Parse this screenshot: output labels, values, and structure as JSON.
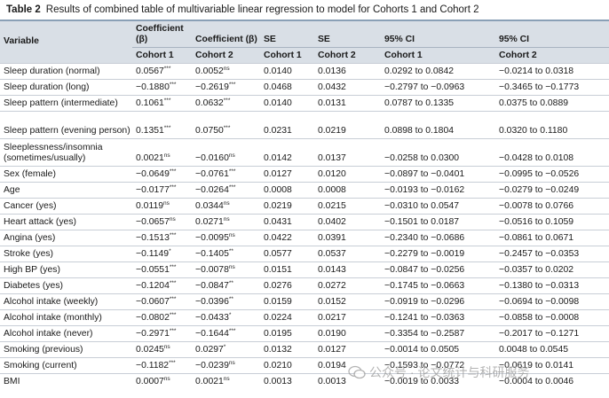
{
  "caption": {
    "label": "Table 2",
    "title": "Results of combined table of multivariable linear regression to model for Cohorts 1 and Cohort 2"
  },
  "header": {
    "variable": "Variable",
    "coef1": "Coefficient (β)",
    "coef2": "Coefficient (β)",
    "se1": "SE",
    "se2": "SE",
    "ci1": "95% CI",
    "ci2": "95% CI",
    "cohort1": "Cohort 1",
    "cohort2": "Cohort 2"
  },
  "rows": [
    {
      "label": "Sleep duration (normal)",
      "b1": "0.0567",
      "s1": "***",
      "b2": "0.0052",
      "s2": "ns",
      "se1": "0.0140",
      "se2": "0.0136",
      "ci1": "0.0292 to 0.0842",
      "ci2": "−0.0214 to 0.0318"
    },
    {
      "label": "Sleep duration (long)",
      "b1": "−0.1880",
      "s1": "***",
      "b2": "−0.2619",
      "s2": "***",
      "se1": "0.0468",
      "se2": "0.0432",
      "ci1": "−0.2797 to −0.0963",
      "ci2": "−0.3465 to −0.1773"
    },
    {
      "label": "Sleep pattern (intermediate)",
      "b1": "0.1061",
      "s1": "***",
      "b2": "0.0632",
      "s2": "***",
      "se1": "0.0140",
      "se2": "0.0131",
      "ci1": "0.0787 to 0.1335",
      "ci2": "0.0375 to 0.0889"
    },
    {
      "label": "Sleep pattern (evening person)",
      "b1": "0.1351",
      "s1": "***",
      "b2": "0.0750",
      "s2": "***",
      "se1": "0.0231",
      "se2": "0.0219",
      "ci1": "0.0898 to 0.1804",
      "ci2": "0.0320 to 0.1180",
      "tall": true
    },
    {
      "label": "Sleeplessness/insomnia (sometimes/usually)",
      "b1": "0.0021",
      "s1": "ns",
      "b2": "−0.0160",
      "s2": "ns",
      "se1": "0.0142",
      "se2": "0.0137",
      "ci1": "−0.0258 to 0.0300",
      "ci2": "−0.0428 to 0.0108",
      "tall": true
    },
    {
      "label": "Sex (female)",
      "b1": "−0.0649",
      "s1": "***",
      "b2": "−0.0761",
      "s2": "***",
      "se1": "0.0127",
      "se2": "0.0120",
      "ci1": "−0.0897 to −0.0401",
      "ci2": "−0.0995 to −0.0526"
    },
    {
      "label": "Age",
      "b1": "−0.0177",
      "s1": "***",
      "b2": "−0.0264",
      "s2": "***",
      "se1": "0.0008",
      "se2": "0.0008",
      "ci1": "−0.0193 to −0.0162",
      "ci2": "−0.0279 to −0.0249"
    },
    {
      "label": "Cancer (yes)",
      "b1": "0.0119",
      "s1": "ns",
      "b2": "0.0344",
      "s2": "ns",
      "se1": "0.0219",
      "se2": "0.0215",
      "ci1": "−0.0310 to 0.0547",
      "ci2": "−0.0078 to 0.0766"
    },
    {
      "label": "Heart attack (yes)",
      "b1": "−0.0657",
      "s1": "ns",
      "b2": "0.0271",
      "s2": "ns",
      "se1": "0.0431",
      "se2": "0.0402",
      "ci1": "−0.1501 to 0.0187",
      "ci2": "−0.0516 to 0.1059"
    },
    {
      "label": "Angina (yes)",
      "b1": "−0.1513",
      "s1": "***",
      "b2": "−0.0095",
      "s2": "ns",
      "se1": "0.0422",
      "se2": "0.0391",
      "ci1": "−0.2340 to −0.0686",
      "ci2": "−0.0861 to 0.0671"
    },
    {
      "label": "Stroke (yes)",
      "b1": "−0.1149",
      "s1": "*",
      "b2": "−0.1405",
      "s2": "**",
      "se1": "0.0577",
      "se2": "0.0537",
      "ci1": "−0.2279 to −0.0019",
      "ci2": "−0.2457 to −0.0353"
    },
    {
      "label": "High BP (yes)",
      "b1": "−0.0551",
      "s1": "***",
      "b2": "−0.0078",
      "s2": "ns",
      "se1": "0.0151",
      "se2": "0.0143",
      "ci1": "−0.0847 to −0.0256",
      "ci2": "−0.0357 to 0.0202"
    },
    {
      "label": "Diabetes (yes)",
      "b1": "−0.1204",
      "s1": "***",
      "b2": "−0.0847",
      "s2": "**",
      "se1": "0.0276",
      "se2": "0.0272",
      "ci1": "−0.1745 to −0.0663",
      "ci2": "−0.1380 to −0.0313"
    },
    {
      "label": "Alcohol intake (weekly)",
      "b1": "−0.0607",
      "s1": "***",
      "b2": "−0.0396",
      "s2": "**",
      "se1": "0.0159",
      "se2": "0.0152",
      "ci1": "−0.0919 to −0.0296",
      "ci2": "−0.0694 to −0.0098"
    },
    {
      "label": "Alcohol intake (monthly)",
      "b1": "−0.0802",
      "s1": "***",
      "b2": "−0.0433",
      "s2": "*",
      "se1": "0.0224",
      "se2": "0.0217",
      "ci1": "−0.1241 to −0.0363",
      "ci2": "−0.0858 to −0.0008"
    },
    {
      "label": "Alcohol intake (never)",
      "b1": "−0.2971",
      "s1": "***",
      "b2": "−0.1644",
      "s2": "***",
      "se1": "0.0195",
      "se2": "0.0190",
      "ci1": "−0.3354 to −0.2587",
      "ci2": "−0.2017 to −0.1271"
    },
    {
      "label": "Smoking (previous)",
      "b1": "0.0245",
      "s1": "ns",
      "b2": "0.0297",
      "s2": "*",
      "se1": "0.0132",
      "se2": "0.0127",
      "ci1": "−0.0014 to 0.0505",
      "ci2": "0.0048 to 0.0545"
    },
    {
      "label": "Smoking (current)",
      "b1": "−0.1182",
      "s1": "***",
      "b2": "−0.0239",
      "s2": "ns",
      "se1": "0.0210",
      "se2": "0.0194",
      "ci1": "−0.1593 to −0.0772",
      "ci2": "−0.0619 to 0.0141"
    },
    {
      "label": "BMI",
      "b1": "0.0007",
      "s1": "ns",
      "b2": "0.0021",
      "s2": "ns",
      "se1": "0.0013",
      "se2": "0.0013",
      "ci1": "−0.0019 to 0.0033",
      "ci2": "−0.0004 to 0.0046"
    }
  ],
  "watermark": {
    "text": "公众号 · 论文统计与科研服务",
    "icon": "wechat-icon"
  }
}
